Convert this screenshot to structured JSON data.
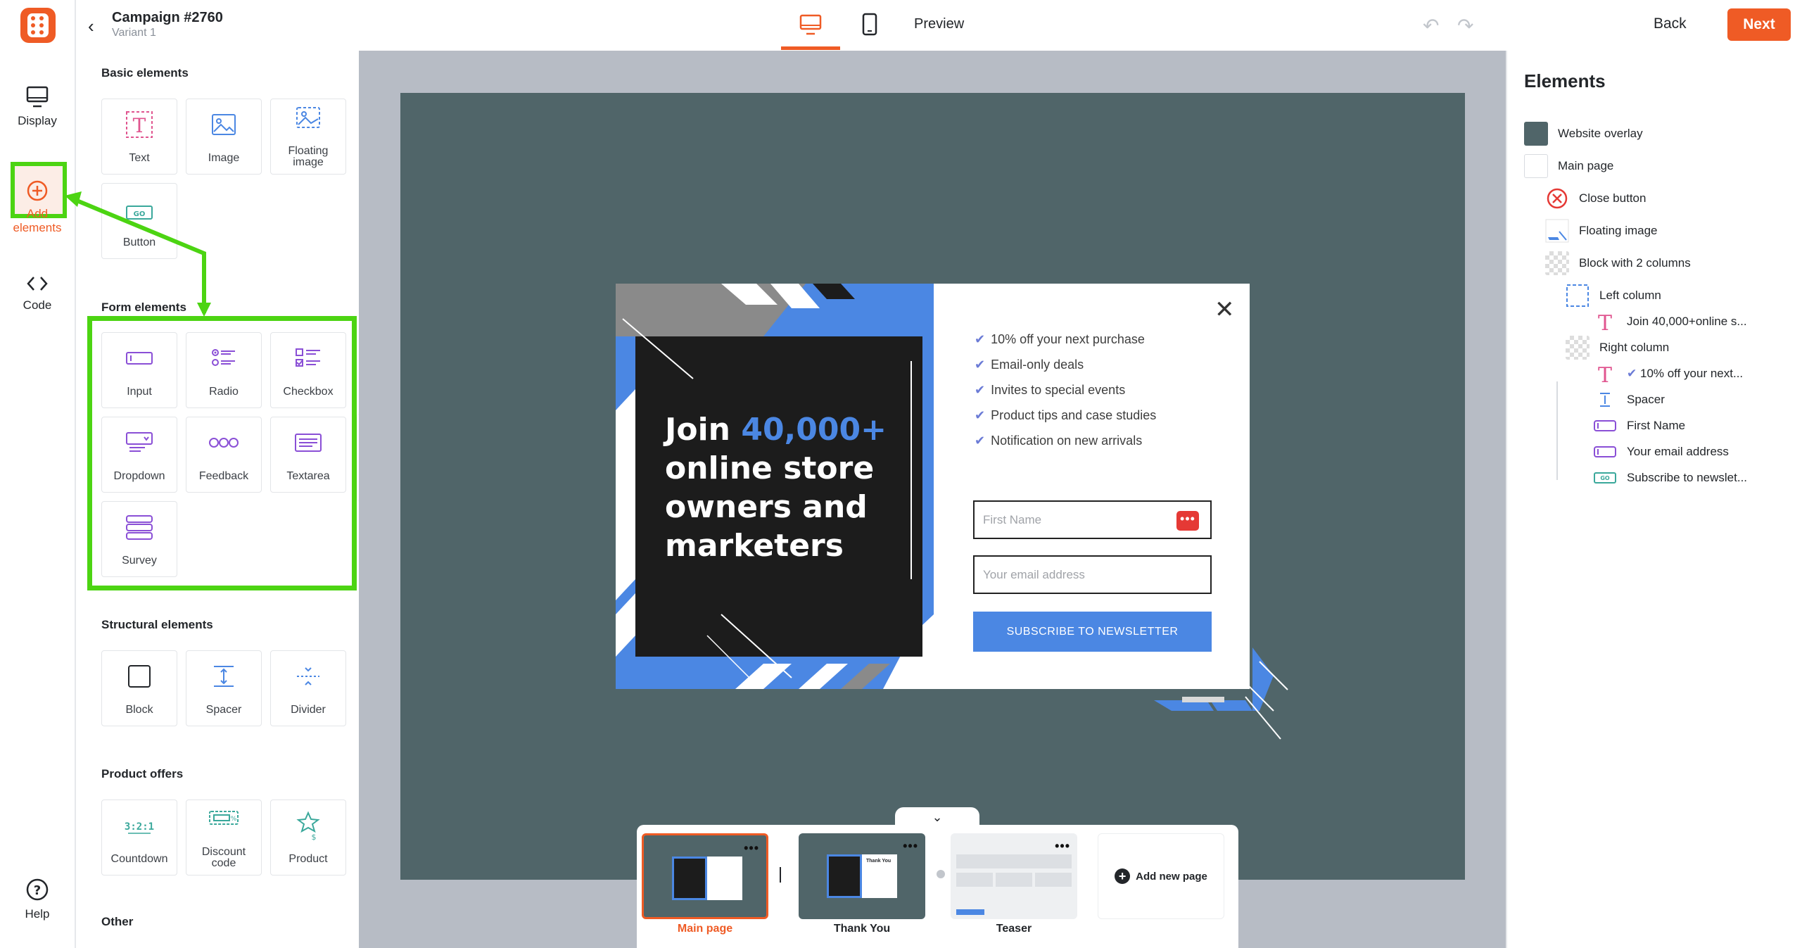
{
  "app": {
    "campaign_title": "Campaign #2760",
    "variant": "Variant 1",
    "accent_color": "#ef5b25",
    "highlight_color": "#4cd412"
  },
  "rail": {
    "display": "Display",
    "add_elements_line1": "Add",
    "add_elements_line2": "elements",
    "code": "Code",
    "help": "Help"
  },
  "panel": {
    "basic_title": "Basic elements",
    "basic": [
      "Text",
      "Image",
      "Floating",
      "image",
      "Button"
    ],
    "form_title": "Form elements",
    "form": [
      "Input",
      "Radio",
      "Checkbox",
      "Dropdown",
      "Feedback",
      "Textarea",
      "Survey"
    ],
    "structural_title": "Structural elements",
    "structural": [
      "Block",
      "Spacer",
      "Divider"
    ],
    "product_title": "Product offers",
    "product": [
      "Countdown",
      "Discount",
      "code",
      "Product"
    ],
    "other_title": "Other"
  },
  "topbar": {
    "preview": "Preview",
    "back": "Back",
    "next": "Next",
    "active_device": "desktop"
  },
  "popup": {
    "headline_1": "Join ",
    "headline_highlight": "40,000+",
    "headline_2": "online store owners and marketers",
    "bullets": [
      "10% off your next purchase",
      "Email-only deals",
      "Invites to special events",
      "Product tips and case studies",
      "Notification on new arrivals"
    ],
    "first_name_placeholder": "First Name",
    "email_placeholder": "Your email address",
    "subscribe": "SUBSCRIBE TO NEWSLETTER",
    "autofill_dots": "•••"
  },
  "pages": {
    "items": [
      {
        "label": "Main page",
        "active": true
      },
      {
        "label": "Thank You",
        "active": false
      },
      {
        "label": "Teaser",
        "active": false
      }
    ],
    "add_new": "Add new page",
    "mini_text": "Thank You",
    "dots": "•••"
  },
  "layers": {
    "title": "Elements",
    "items": [
      "Website overlay",
      "Main page",
      "Close button",
      "Floating image",
      "Block with 2 columns",
      "Left column",
      "Join 40,000+online s...",
      "Right column",
      "10% off your next...",
      "Spacer",
      "First Name",
      "Your email address",
      "Subscribe to newslet..."
    ],
    "overlay_color": "#506569"
  }
}
